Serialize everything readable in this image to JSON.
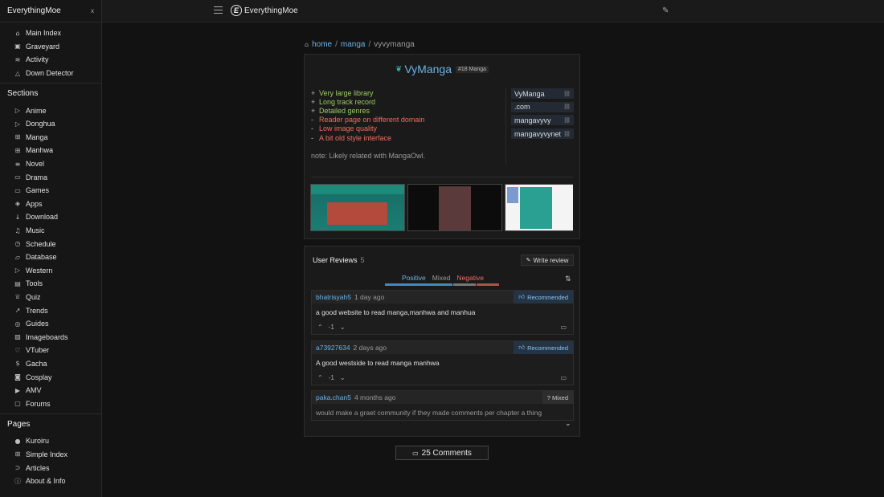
{
  "sidebar": {
    "title": "EverythingMoe",
    "close_label": "x",
    "top_items": [
      {
        "label": "Main Index",
        "icon": "home-icon",
        "glyph": "⌂"
      },
      {
        "label": "Graveyard",
        "icon": "tombstone-icon",
        "glyph": "▣"
      },
      {
        "label": "Activity",
        "icon": "rss-icon",
        "glyph": "≋"
      },
      {
        "label": "Down Detector",
        "icon": "warning-icon",
        "glyph": "△"
      }
    ],
    "sections_title": "Sections",
    "sections": [
      {
        "label": "Anime",
        "icon": "play-icon",
        "glyph": "▷"
      },
      {
        "label": "Donghua",
        "icon": "play-icon",
        "glyph": "▷"
      },
      {
        "label": "Manga",
        "icon": "grid-icon",
        "glyph": "⊞"
      },
      {
        "label": "Manhwa",
        "icon": "grid-icon",
        "glyph": "⊞"
      },
      {
        "label": "Novel",
        "icon": "text-icon",
        "glyph": "≡"
      },
      {
        "label": "Drama",
        "icon": "camera-icon",
        "glyph": "▭"
      },
      {
        "label": "Games",
        "icon": "monitor-icon",
        "glyph": "▭"
      },
      {
        "label": "Apps",
        "icon": "layers-icon",
        "glyph": "◈"
      },
      {
        "label": "Download",
        "icon": "download-icon",
        "glyph": "↓"
      },
      {
        "label": "Music",
        "icon": "music-icon",
        "glyph": "♫"
      },
      {
        "label": "Schedule",
        "icon": "clock-icon",
        "glyph": "◷"
      },
      {
        "label": "Database",
        "icon": "folder-icon",
        "glyph": "▱"
      },
      {
        "label": "Western",
        "icon": "play-icon",
        "glyph": "▷"
      },
      {
        "label": "Tools",
        "icon": "toolbox-icon",
        "glyph": "▤"
      },
      {
        "label": "Quiz",
        "icon": "trophy-icon",
        "glyph": "♕"
      },
      {
        "label": "Trends",
        "icon": "chart-icon",
        "glyph": "↗"
      },
      {
        "label": "Guides",
        "icon": "compass-icon",
        "glyph": "◎"
      },
      {
        "label": "Imageboards",
        "icon": "image-icon",
        "glyph": "▨"
      },
      {
        "label": "VTuber",
        "icon": "heart-icon",
        "glyph": "♡"
      },
      {
        "label": "Gacha",
        "icon": "dollar-icon",
        "glyph": "$"
      },
      {
        "label": "Cosplay",
        "icon": "camera-icon",
        "glyph": "◙"
      },
      {
        "label": "AMV",
        "icon": "film-icon",
        "glyph": "▶"
      },
      {
        "label": "Forums",
        "icon": "chat-icon",
        "glyph": "▢"
      }
    ],
    "pages_title": "Pages",
    "pages": [
      {
        "label": "Kuroiru",
        "icon": "kuroiru-icon",
        "glyph": "●"
      },
      {
        "label": "Simple Index",
        "icon": "grid-icon",
        "glyph": "⊞"
      },
      {
        "label": "Articles",
        "icon": "tag-icon",
        "glyph": "⊃"
      },
      {
        "label": "About & Info",
        "icon": "info-icon",
        "glyph": "ⓘ"
      }
    ]
  },
  "topbar": {
    "logo_letter": "E",
    "site_name": "EverythingMoe"
  },
  "breadcrumb": {
    "home": "home",
    "sep": "/",
    "category": "manga",
    "current": "vyvymanga"
  },
  "site": {
    "name": "VyManga",
    "rank": "#18 Manga",
    "features": [
      {
        "sign": "+",
        "text": "Very large library",
        "kind": "pos"
      },
      {
        "sign": "+",
        "text": "Long track record",
        "kind": "pos"
      },
      {
        "sign": "+",
        "text": "Detailed genres",
        "kind": "pos"
      },
      {
        "sign": "-",
        "text": "Reader page on different domain",
        "kind": "neg"
      },
      {
        "sign": "-",
        "text": "Low image quality",
        "kind": "neg"
      },
      {
        "sign": "-",
        "text": "A bit old style interface",
        "kind": "neg"
      }
    ],
    "note": "note: Likely related with MangaOwl.",
    "links": [
      "VyManga",
      ".com",
      "mangavyvy",
      "mangavyvynet"
    ]
  },
  "reviews": {
    "title": "User Reviews",
    "count": "5",
    "write_label": "Write review",
    "tabs": {
      "positive": "Positive",
      "mixed": "Mixed",
      "negative": "Negative"
    },
    "bar_shares": [
      0.6,
      0.2,
      0.2
    ],
    "bar_colors": [
      "#4a86b8",
      "#777777",
      "#b0524a"
    ],
    "items": [
      {
        "user": "bhatrisyah5",
        "time": "1 day ago",
        "badge": "Recommended",
        "badge_icon": "thumbs-up-icon",
        "text": "a good website to read manga,manhwa and manhua",
        "score": "-1"
      },
      {
        "user": "a73927634",
        "time": "2 days ago",
        "badge": "Recommended",
        "badge_icon": "thumbs-up-icon",
        "text": "A good westside to read manga manhwa",
        "score": "-1"
      },
      {
        "user": "paka.chan5",
        "time": "4 months ago",
        "badge": "? Mixed",
        "badge_icon": "",
        "text": "would make a graet community if they made comments per chapter a thing"
      }
    ]
  },
  "comments_button": "25 Comments"
}
